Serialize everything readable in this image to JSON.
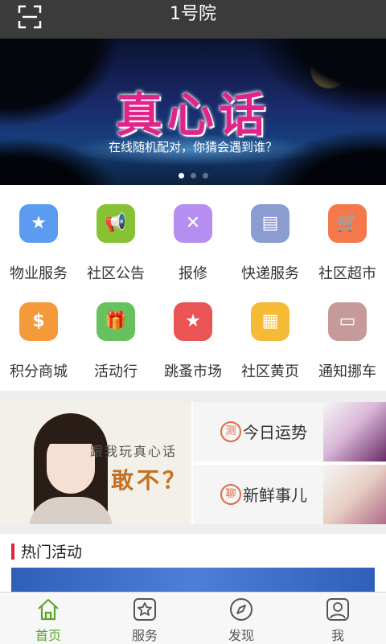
{
  "header": {
    "title": "1号院"
  },
  "banner": {
    "headline": "真心话",
    "subtitle": "在线随机配对，你猜会遇到谁？",
    "dot_count": 3,
    "active_dot": 1
  },
  "services": [
    {
      "label": "物业服务",
      "icon": "badge-icon",
      "color": "#5b9bf0",
      "glyph": "★"
    },
    {
      "label": "社区公告",
      "icon": "megaphone-icon",
      "color": "#86c233",
      "glyph": "📢"
    },
    {
      "label": "报修",
      "icon": "tools-icon",
      "color": "#b58ef0",
      "glyph": "✕"
    },
    {
      "label": "快递服务",
      "icon": "delivery-truck-icon",
      "color": "#8a9cd0",
      "glyph": "▤"
    },
    {
      "label": "社区超市",
      "icon": "shopping-cart-icon",
      "color": "#f5784a",
      "glyph": "🛒"
    },
    {
      "label": "积分商城",
      "icon": "coin-icon",
      "color": "#f59a3a",
      "glyph": "$"
    },
    {
      "label": "活动行",
      "icon": "gift-icon",
      "color": "#67c15e",
      "glyph": "🎁"
    },
    {
      "label": "跳蚤市场",
      "icon": "bag-icon",
      "color": "#ea5455",
      "glyph": "★"
    },
    {
      "label": "社区黄页",
      "icon": "grid-icon",
      "color": "#f6bb36",
      "glyph": "▦"
    },
    {
      "label": "通知挪车",
      "icon": "car-icon",
      "color": "#c79a9a",
      "glyph": "▭"
    }
  ],
  "promo": {
    "left_line1": "跟我玩真心话",
    "left_line2": "敢不？",
    "cards": [
      {
        "badge": "测",
        "label": "今日运势"
      },
      {
        "badge": "聊",
        "label": "新鲜事儿"
      }
    ]
  },
  "hot": {
    "title": "热门活动"
  },
  "tabbar": {
    "tabs": [
      {
        "label": "首页",
        "icon": "home-icon",
        "active": true
      },
      {
        "label": "服务",
        "icon": "star-icon",
        "active": false
      },
      {
        "label": "发现",
        "icon": "compass-icon",
        "active": false
      },
      {
        "label": "我",
        "icon": "user-icon",
        "active": false
      }
    ],
    "active_color": "#5aa62a"
  }
}
